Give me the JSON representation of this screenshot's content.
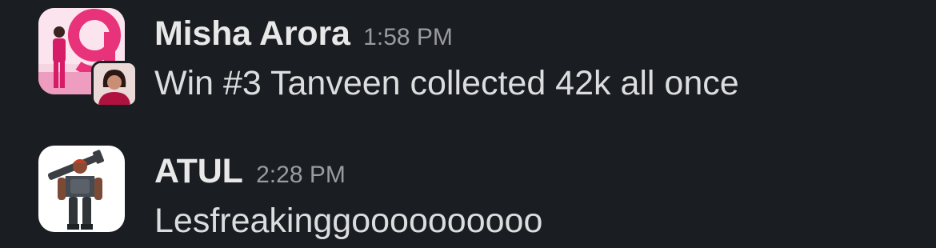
{
  "messages": [
    {
      "author": "Misha Arora",
      "time": "1:58 PM",
      "text": "Win #3 Tanveen collected 42k all once",
      "avatar_icon": "pink-studio-avatar-icon",
      "mini_avatar_icon": "woman-portrait-avatar-icon"
    },
    {
      "author": "ATUL",
      "time": "2:28 PM",
      "text": "Lesfreakinggoooooooooo",
      "avatar_icon": "armored-soldier-avatar-icon"
    }
  ],
  "colors": {
    "background": "#1a1d21",
    "author": "#e8e8e8",
    "timestamp": "#9a9b9d",
    "message_text": "#dcddde",
    "brand_pink": "#e8327a"
  }
}
